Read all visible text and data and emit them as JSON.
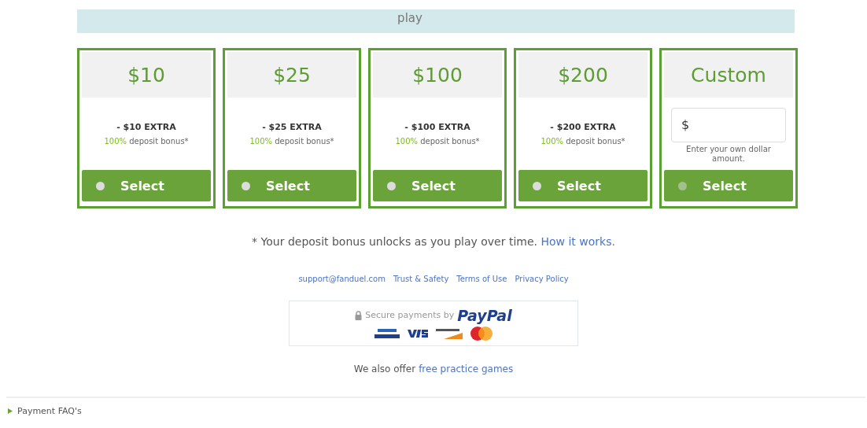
{
  "banner": {
    "text": "play"
  },
  "options": [
    {
      "kind": "preset",
      "amount": "$10",
      "extra": "- $10 EXTRA",
      "percent": "100%",
      "bonus": "deposit bonus*",
      "button": "Select",
      "selected": false
    },
    {
      "kind": "preset",
      "amount": "$25",
      "extra": "- $25 EXTRA",
      "percent": "100%",
      "bonus": "deposit bonus*",
      "button": "Select",
      "selected": false
    },
    {
      "kind": "preset",
      "amount": "$100",
      "extra": "- $100 EXTRA",
      "percent": "100%",
      "bonus": "deposit bonus*",
      "button": "Select",
      "selected": false
    },
    {
      "kind": "preset",
      "amount": "$200",
      "extra": "- $200 EXTRA",
      "percent": "100%",
      "bonus": "deposit bonus*",
      "button": "Select",
      "selected": false
    },
    {
      "kind": "custom",
      "amount": "Custom",
      "field_prefix": "$",
      "hint": "Enter your own dollar amount.",
      "button": "Select",
      "selected": false
    }
  ],
  "note": {
    "text": "* Your deposit bonus unlocks as you play over time.",
    "link": "How it works."
  },
  "footer_links": [
    "support@fanduel.com",
    "Trust & Safety",
    "Terms of Use",
    "Privacy Policy"
  ],
  "payments": {
    "label": "Secure payments by",
    "brand": "PayPal"
  },
  "practice": {
    "text": "We also offer",
    "link": "free practice games"
  },
  "faq": {
    "label": "Payment FAQ's",
    "expanded": false
  }
}
